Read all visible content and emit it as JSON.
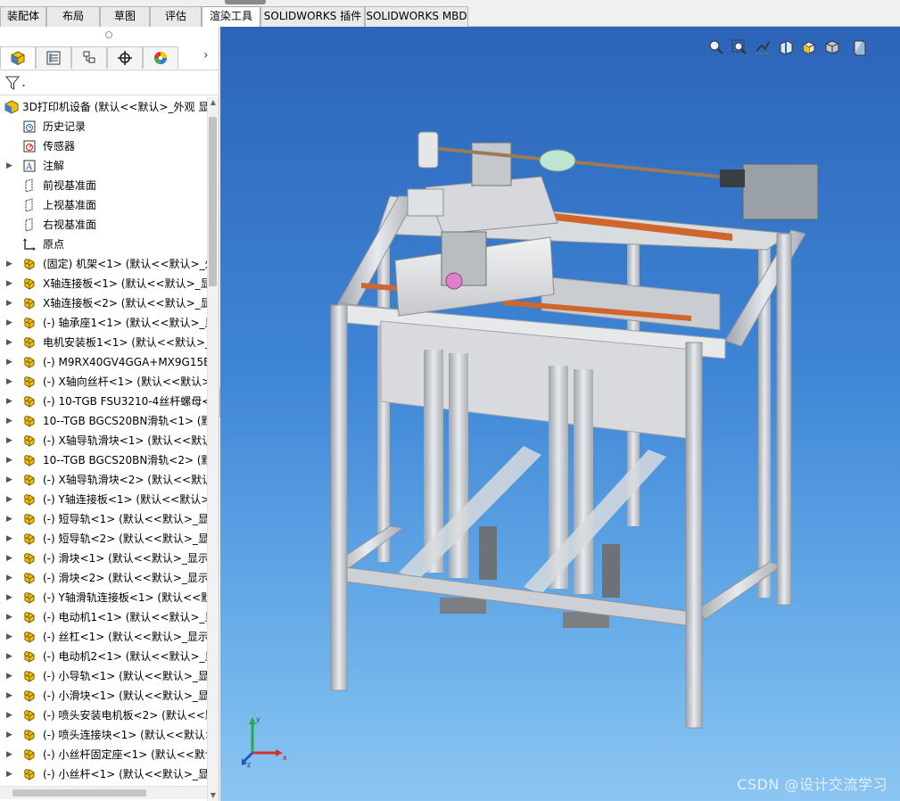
{
  "tabs": [
    {
      "label": "装配体"
    },
    {
      "label": "布局"
    },
    {
      "label": "草图"
    },
    {
      "label": "评估"
    },
    {
      "label": "渲染工具"
    },
    {
      "label": "SOLIDWORKS 插件"
    },
    {
      "label": "SOLIDWORKS MBD"
    }
  ],
  "active_tab": "渲染工具",
  "feature_manager": {
    "panel_tabs": [
      "featuremanager-icon",
      "propertymanager-icon",
      "configurationmanager-icon",
      "dimxpert-icon",
      "display-manager-icon"
    ],
    "root": {
      "label": "3D打印机设备 (默认<<默认>_外观 显"
    },
    "fixed_items": [
      {
        "label": "历史记录",
        "icon": "history-icon",
        "arrow": false
      },
      {
        "label": "传感器",
        "icon": "sensor-icon",
        "arrow": false
      },
      {
        "label": "注解",
        "icon": "annotation-icon",
        "arrow": true
      },
      {
        "label": "前视基准面",
        "icon": "plane-icon",
        "arrow": false
      },
      {
        "label": "上视基准面",
        "icon": "plane-icon",
        "arrow": false
      },
      {
        "label": "右视基准面",
        "icon": "plane-icon",
        "arrow": false
      },
      {
        "label": "原点",
        "icon": "origin-icon",
        "arrow": false
      }
    ],
    "components": [
      {
        "label": "(固定) 机架<1> (默认<<默认>_外"
      },
      {
        "label": "X轴连接板<1> (默认<<默认>_显"
      },
      {
        "label": "X轴连接板<2> (默认<<默认>_显"
      },
      {
        "label": "(-) 轴承座1<1> (默认<<默认>_显"
      },
      {
        "label": "电机安装板1<1> (默认<<默认>_"
      },
      {
        "label": "(-) M9RX40GV4GGA+MX9G15B"
      },
      {
        "label": "(-) X轴向丝杆<1> (默认<<默认>_"
      },
      {
        "label": "(-) 10-TGB FSU3210-4丝杆螺母<"
      },
      {
        "label": "10--TGB BGCS20BN滑轨<1> (默"
      },
      {
        "label": "(-) X轴导轨滑块<1> (默认<<默认"
      },
      {
        "label": "10--TGB BGCS20BN滑轨<2> (默"
      },
      {
        "label": "(-) X轴导轨滑块<2> (默认<<默认"
      },
      {
        "label": "(-) Y轴连接板<1> (默认<<默认>_"
      },
      {
        "label": "(-) 短导轨<1> (默认<<默认>_显示"
      },
      {
        "label": "(-) 短导轨<2> (默认<<默认>_显示"
      },
      {
        "label": "(-) 滑块<1> (默认<<默认>_显示状"
      },
      {
        "label": "(-) 滑块<2> (默认<<默认>_显示状"
      },
      {
        "label": "(-) Y轴滑轨连接板<1> (默认<<默"
      },
      {
        "label": "(-) 电动机1<1> (默认<<默认>_显"
      },
      {
        "label": "(-) 丝杠<1> (默认<<默认>_显示状"
      },
      {
        "label": "(-) 电动机2<1> (默认<<默认>_显"
      },
      {
        "label": "(-) 小导轨<1> (默认<<默认>_显示"
      },
      {
        "label": "(-) 小滑块<1> (默认<<默认>_显示"
      },
      {
        "label": "(-) 喷头安装电机板<2> (默认<<默"
      },
      {
        "label": "(-) 喷头连接块<1> (默认<<默认>_"
      },
      {
        "label": "(-) 小丝杆固定座<1> (默认<<默认"
      },
      {
        "label": "(-) 小丝杆<1> (默认<<默认>_显示"
      }
    ]
  },
  "viewport": {
    "heads_up_icons": [
      "zoom-to-fit-icon",
      "zoom-area-icon",
      "previous-view-icon",
      "section-view-icon",
      "view-orientation-icon",
      "display-style-icon",
      "hide-show-icon"
    ],
    "triad": {
      "x": "x",
      "y": "y",
      "z": "z"
    },
    "watermark": "CSDN @设计交流学习"
  },
  "colors": {
    "viewport_top": "#2c64b8",
    "viewport_bottom": "#8cc6f2",
    "frame": "#c8ccd0",
    "rail_accent": "#d0662c",
    "part_icon": "#f2c100"
  }
}
